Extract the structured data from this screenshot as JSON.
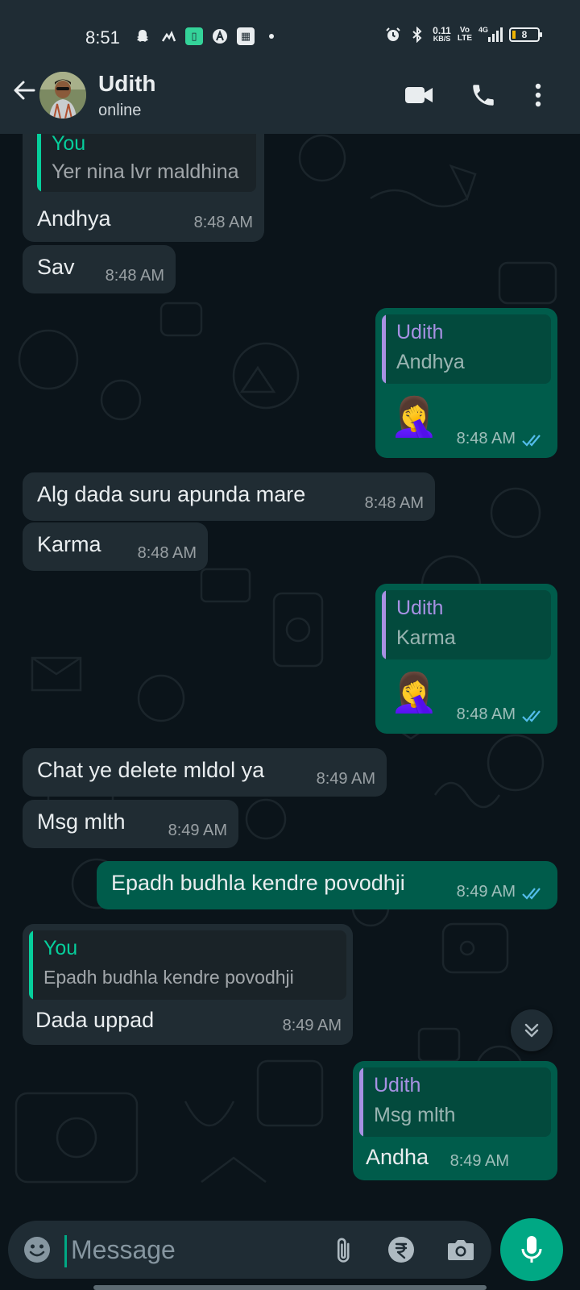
{
  "status_bar": {
    "time": "8:51",
    "net_speed_top": "0.11",
    "net_speed_bottom": "KB/S",
    "volte_top": "Vo",
    "volte_bottom": "LTE",
    "network": "4G",
    "battery": "8"
  },
  "header": {
    "contact_name": "Udith",
    "contact_status": "online"
  },
  "messages": [
    {
      "id": "m1",
      "dir": "in",
      "quote_author": "You",
      "quote_text": "Yer nina lvr maldhina",
      "text": "Andhya",
      "time": "8:48 AM"
    },
    {
      "id": "m2",
      "dir": "in",
      "text": "Sav",
      "time": "8:48 AM"
    },
    {
      "id": "m3",
      "dir": "out",
      "quote_author": "Udith",
      "quote_text": "Andhya",
      "emoji": "🤦‍♀️",
      "time": "8:48 AM",
      "status": "read"
    },
    {
      "id": "m4",
      "dir": "in",
      "text": "Alg dada suru apunda mare",
      "time": "8:48 AM"
    },
    {
      "id": "m5",
      "dir": "in",
      "text": "Karma",
      "time": "8:48 AM"
    },
    {
      "id": "m6",
      "dir": "out",
      "quote_author": "Udith",
      "quote_text": "Karma",
      "emoji": "🤦‍♀️",
      "time": "8:48 AM",
      "status": "read"
    },
    {
      "id": "m7",
      "dir": "in",
      "text": "Chat ye delete mldol ya",
      "time": "8:49 AM"
    },
    {
      "id": "m8",
      "dir": "in",
      "text": "Msg mlth",
      "time": "8:49 AM"
    },
    {
      "id": "m9",
      "dir": "out",
      "text": "Epadh budhla kendre povodhji",
      "time": "8:49 AM",
      "status": "read"
    },
    {
      "id": "m10",
      "dir": "in",
      "quote_author": "You",
      "quote_text": "Epadh budhla kendre povodhji",
      "text": "Dada uppad",
      "time": "8:49 AM"
    },
    {
      "id": "m11",
      "dir": "out",
      "quote_author": "Udith",
      "quote_text": "Msg mlth",
      "text": "Andha",
      "time": "8:49 AM"
    }
  ],
  "composer": {
    "placeholder": "Message"
  },
  "colors": {
    "header_bg": "#1f2c34",
    "chat_bg": "#0b141a",
    "incoming_bubble": "#202c33",
    "outgoing_bubble": "#005c4b",
    "accent": "#00a884",
    "you_quote": "#06cf9c",
    "udith_quote": "#a791e3",
    "read_tick": "#53bdeb"
  },
  "icons": {
    "back": "arrow-left-icon",
    "video": "video-camera-icon",
    "call": "phone-icon",
    "menu": "more-vertical-icon",
    "emoji": "emoji-icon",
    "attach": "paperclip-icon",
    "payment": "rupee-icon",
    "camera": "camera-icon",
    "mic": "microphone-icon",
    "scroll": "double-chevron-down-icon"
  }
}
